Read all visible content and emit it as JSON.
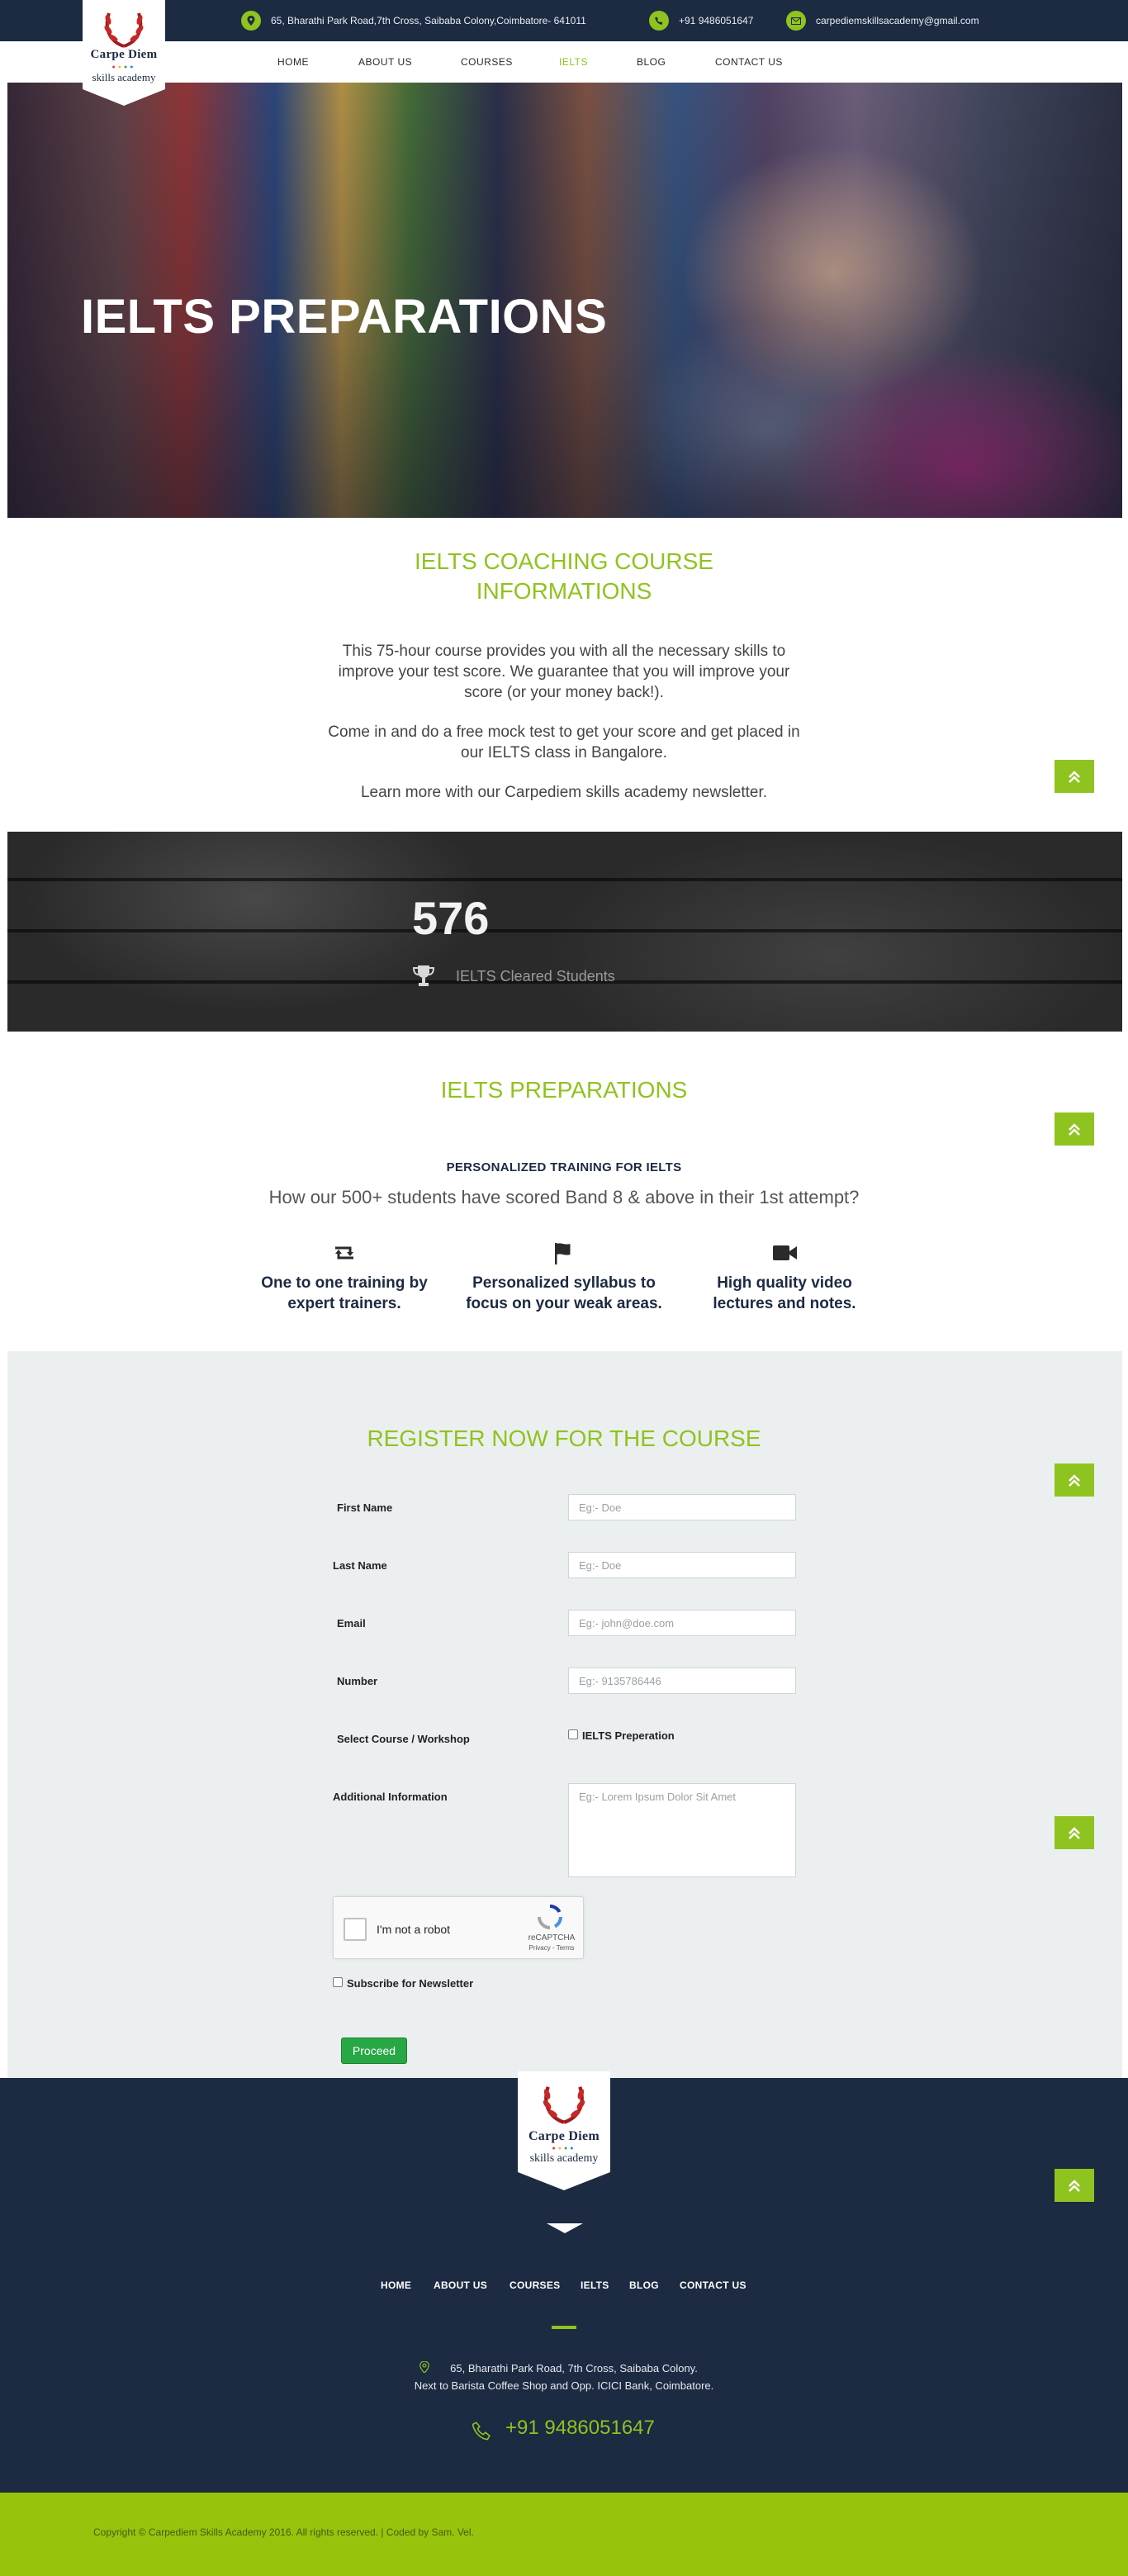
{
  "topbar": {
    "address": "65, Bharathi Park Road,7th Cross, Saibaba Colony,Coimbatore- 641011",
    "phone": "+91 9486051647",
    "email": "carpediemskillsacademy@gmail.com",
    "icons": [
      "location-icon",
      "phone-icon",
      "email-icon"
    ]
  },
  "logo": {
    "line1": "Carpe Diem",
    "line2": "skills academy"
  },
  "nav": {
    "items": [
      "HOME",
      "ABOUT US",
      "COURSES",
      "IELTS",
      "BLOG",
      "CONTACT US"
    ],
    "active": "IELTS"
  },
  "hero": {
    "title": "IELTS PREPARATIONS"
  },
  "course_info": {
    "title": "IELTS COACHING COURSE INFORMATIONS",
    "paragraphs": [
      "This 75-hour course provides you with all the necessary skills to improve your test score. We guarantee that you will improve your score (or your money back!).",
      "Come in and do a free mock test to get your score and get placed in our IELTS class in Bangalore.",
      "Learn more with our Carpediem skills academy newsletter."
    ]
  },
  "counter": {
    "value": "576",
    "label": "IELTS Cleared Students",
    "icon": "trophy-icon"
  },
  "preparations": {
    "title": "IELTS PREPARATIONS",
    "subtitle": "PERSONALIZED TRAINING FOR IELTS",
    "question": "How our 500+ students have scored Band 8 & above in their 1st attempt?",
    "features": [
      {
        "icon": "retweet-icon",
        "text": "One to one training by expert trainers."
      },
      {
        "icon": "flag-icon",
        "text": "Personalized syllabus to focus on your weak areas."
      },
      {
        "icon": "video-camera-icon",
        "text": "High quality video lectures and notes."
      }
    ]
  },
  "register": {
    "title": "REGISTER NOW FOR THE COURSE",
    "fields": {
      "first_name": {
        "label": "First Name",
        "placeholder": "Eg:- Doe"
      },
      "last_name": {
        "label": "Last Name",
        "placeholder": "Eg:- Doe"
      },
      "email": {
        "label": "Email",
        "placeholder": "Eg:- john@doe.com"
      },
      "number": {
        "label": "Number",
        "placeholder": "Eg:- 9135786446"
      },
      "course": {
        "label": "Select Course / Workshop",
        "option": "IELTS Preperation"
      },
      "additional": {
        "label": "Additional Information",
        "placeholder": "Eg:- Lorem Ipsum Dolor Sit Amet"
      }
    },
    "captcha": {
      "label": "I'm not a robot",
      "brand": "reCAPTCHA",
      "links": "Privacy - Terms"
    },
    "newsletter": "Subscribe for Newsletter",
    "submit": "Proceed"
  },
  "footer": {
    "nav": [
      "HOME",
      "ABOUT US",
      "COURSES",
      "IELTS",
      "BLOG",
      "CONTACT US"
    ],
    "address_line1": "65, Bharathi Park Road, 7th Cross, Saibaba Colony.",
    "address_line2": "Next to Barista Coffee Shop and Opp. ICICI Bank, Coimbatore.",
    "phone": "+91 9486051647",
    "copyright": "Copyright © Carpediem Skills Academy 2016. All rights reserved. | Coded by Sam. Vel."
  },
  "colors": {
    "accent": "#8fc31f",
    "navy": "#1c2a42",
    "footer_bar": "#98c30c",
    "button": "#28a745"
  }
}
